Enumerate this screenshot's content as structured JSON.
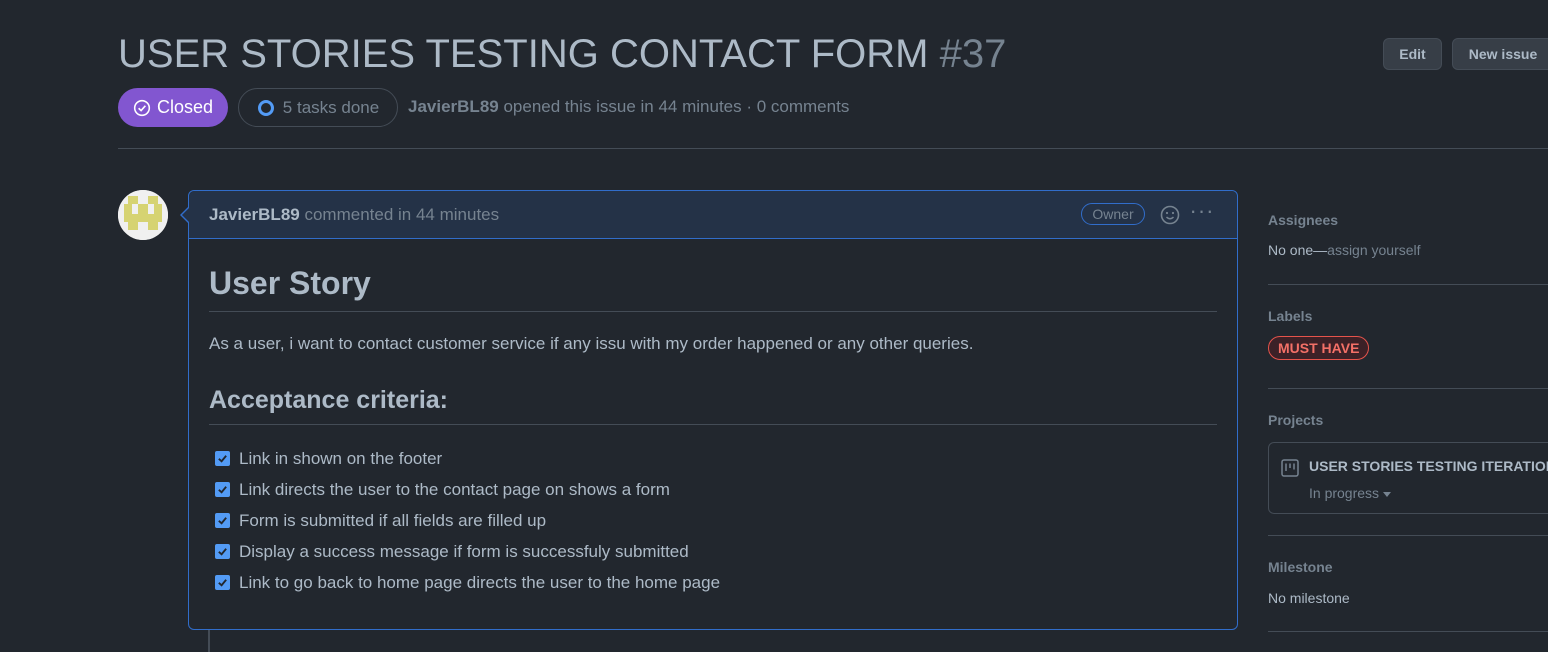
{
  "issue": {
    "title": "USER STORIES TESTING CONTACT FORM",
    "number": "#37",
    "state": "Closed",
    "tasks": "5 tasks done",
    "author": "JavierBL89",
    "meta": "opened this issue in 44 minutes · 0 comments"
  },
  "header": {
    "edit_label": "Edit",
    "new_issue_label": "New issue"
  },
  "comment": {
    "author": "JavierBL89",
    "meta": "commented in 44 minutes",
    "role": "Owner",
    "heading": "User Story",
    "story": "As a user, i want to contact customer service if any issu with my order happened or any other queries.",
    "criteria_heading": "Acceptance criteria:",
    "tasks": [
      "Link in shown on the footer",
      "Link directs the user to the contact page on shows a form",
      "Form is submitted if all fields are filled up",
      "Display a success message if form is successfuly submitted",
      "Link to go back to home page directs the user to the home page"
    ]
  },
  "sidebar": {
    "assignees": {
      "title": "Assignees",
      "value": "No one—",
      "link": "assign yourself"
    },
    "labels": {
      "title": "Labels",
      "label": "MUST HAVE",
      "label_color": "#f47067"
    },
    "projects": {
      "title": "Projects",
      "name": "USER STORIES TESTING ITERATION",
      "status": "In progress"
    },
    "milestone": {
      "title": "Milestone",
      "value": "No milestone"
    }
  },
  "colors": {
    "background": "#22272e",
    "closed": "#8256d0",
    "accent": "#316dca",
    "checkbox": "#539bf5"
  }
}
